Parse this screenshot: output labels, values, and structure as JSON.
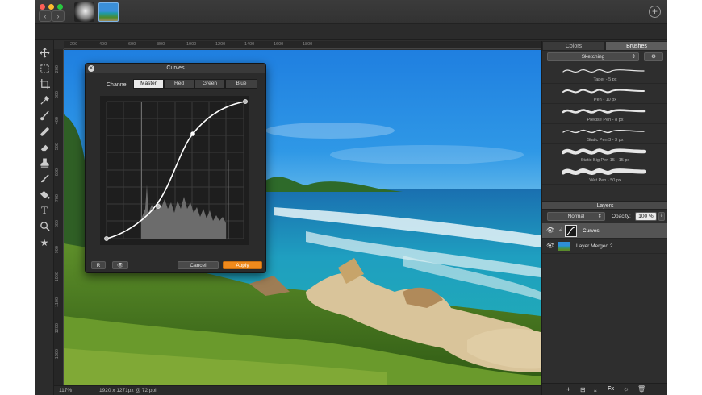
{
  "toolbar": {
    "tools": [
      "move-icon",
      "marquee-icon",
      "crop-icon",
      "eyedropper-icon",
      "brush-icon",
      "healing-icon",
      "eraser-icon",
      "clone-stamp-icon",
      "smudge-icon",
      "paint-bucket-icon",
      "text-icon",
      "zoom-icon",
      "star-icon"
    ]
  },
  "ruler": {
    "h": [
      "200",
      "400",
      "600",
      "800",
      "1000",
      "1200",
      "1400",
      "1600",
      "1800"
    ],
    "v": [
      "200",
      "300",
      "400",
      "500",
      "600",
      "700",
      "800",
      "900",
      "1000",
      "1100",
      "1200",
      "1300"
    ]
  },
  "status": {
    "zoom": "117%",
    "size": "1920 x 1271px @ 72 ppi"
  },
  "panel": {
    "tab_colors": "Colors",
    "tab_brushes": "Brushes",
    "brush_category": "Sketching",
    "brushes": [
      "Taper - 5 px",
      "Pen - 10 px",
      "Precise Pen - 8 px",
      "Static Pen 3 - 3 px",
      "Static Big Pen 15 - 15 px",
      "Wet Pen - 50 px"
    ],
    "layers_title": "Layers",
    "blend_mode": "Normal",
    "opacity_label": "Opacity:",
    "opacity_value": "100 %",
    "layers": [
      "Curves",
      "Layer Merged 2"
    ]
  },
  "dialog": {
    "title": "Curves",
    "channel_label": "Channel",
    "channels": [
      "Master",
      "Red",
      "Green",
      "Blue"
    ],
    "reset_label": "R",
    "cancel_label": "Cancel",
    "apply_label": "Apply"
  }
}
